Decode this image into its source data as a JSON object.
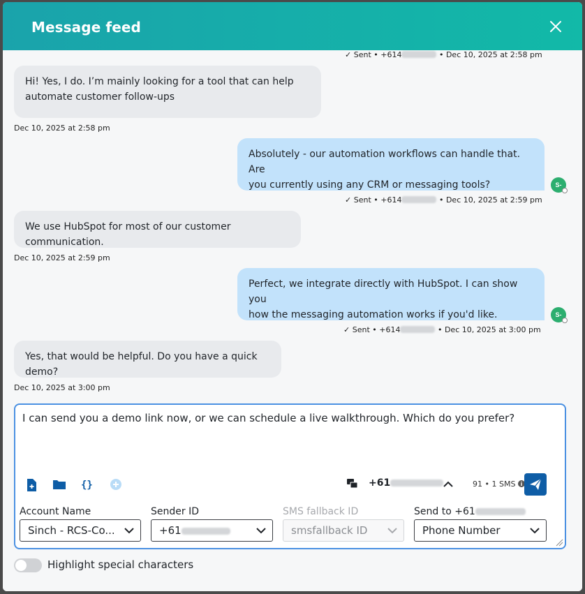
{
  "header": {
    "title": "Message feed",
    "close_icon": "close-icon"
  },
  "feed": {
    "top_meta": {
      "status": "Sent",
      "number_prefix": "+614",
      "date": "Dec 10, 2025 at 2:58 pm"
    },
    "messages": [
      {
        "direction": "inbound",
        "text_line1": "Hi! Yes, I do. I’m mainly looking for a tool that can help",
        "text_line2": "automate customer follow-ups",
        "timestamp": "Dec 10, 2025 at 2:58 pm"
      },
      {
        "direction": "outbound",
        "text_line1": "Absolutely - our automation workflows can handle that. Are",
        "text_line2": "you currently using any CRM or messaging tools?",
        "status": "Sent",
        "number_prefix": "+614",
        "date": "Dec 10, 2025 at 2:59 pm",
        "avatar": "S-"
      },
      {
        "direction": "inbound",
        "text_line1": "We use HubSpot for most of our customer communication.",
        "timestamp": "Dec 10, 2025 at 2:59 pm"
      },
      {
        "direction": "outbound",
        "text_line1": "Perfect, we integrate directly with HubSpot. I can show you",
        "text_line2": "how the messaging automation works if you'd like.",
        "status": "Sent",
        "number_prefix": "+614",
        "date": "Dec 10, 2025 at 3:00 pm",
        "avatar": "S-"
      },
      {
        "direction": "inbound",
        "text_line1": "Yes, that would be helpful. Do you have a quick demo?",
        "timestamp": "Dec 10, 2025 at 3:00 pm"
      }
    ]
  },
  "composer": {
    "draft": "I can send you a demo link now, or we can schedule a live walkthrough. Which do you prefer?",
    "phone_prefix": "+61",
    "counter": "91 • 1 SMS",
    "icons": [
      "add-file-icon",
      "folder-icon",
      "variables-icon",
      "add-circle-icon",
      "conversation-icon",
      "chevron-up-icon",
      "info-icon",
      "send-icon"
    ],
    "fields": {
      "account_label": "Account Name",
      "account_value": "Sinch - RCS-Co...",
      "sender_label": "Sender ID",
      "sender_value": "+61",
      "fallback_label": "SMS fallback ID",
      "fallback_placeholder": "smsfallback ID",
      "sendto_label": "Send to +61",
      "sendto_value": "Phone Number"
    }
  },
  "footer": {
    "toggle_label": "Highlight special characters",
    "toggle_on": false
  },
  "colors": {
    "header_start": "#1aa3ab",
    "header_end": "#12b9a8",
    "outbound_bubble": "#c2e2fb",
    "inbound_bubble": "#e8eaed",
    "send_button": "#0e5da6",
    "avatar": "#2cae6f",
    "focus_border": "#4a90e2"
  }
}
